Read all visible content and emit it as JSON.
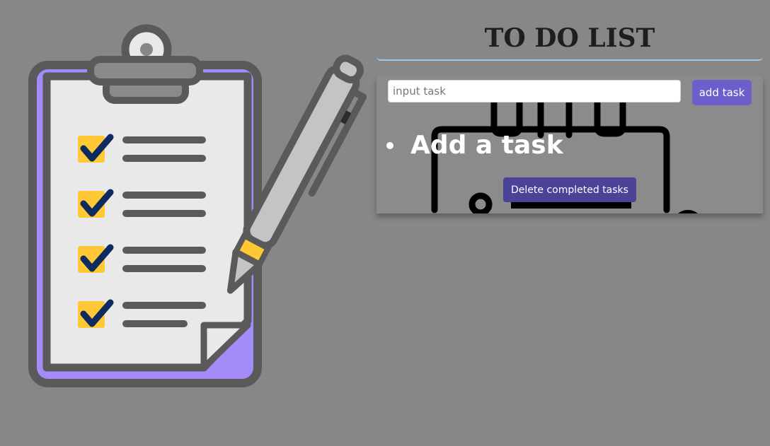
{
  "app": {
    "title": "TO DO LIST"
  },
  "form": {
    "input_value": "",
    "input_placeholder": "input task",
    "add_label": "add task"
  },
  "tasks": [
    {
      "label": "Add a task"
    }
  ],
  "actions": {
    "delete_completed_label": "Delete completed tasks"
  },
  "illustration": {
    "icon": "clipboard-checklist-with-pen",
    "checked_items": 4
  },
  "colors": {
    "page_background": "#878787",
    "clipboard_board": "#a38cf7",
    "checkbox": "#fec935",
    "checkmark": "#0d2b5e",
    "add_button": "#6a5fcb",
    "delete_button": "#4b4398",
    "title_underline": "#9fc8e4"
  }
}
